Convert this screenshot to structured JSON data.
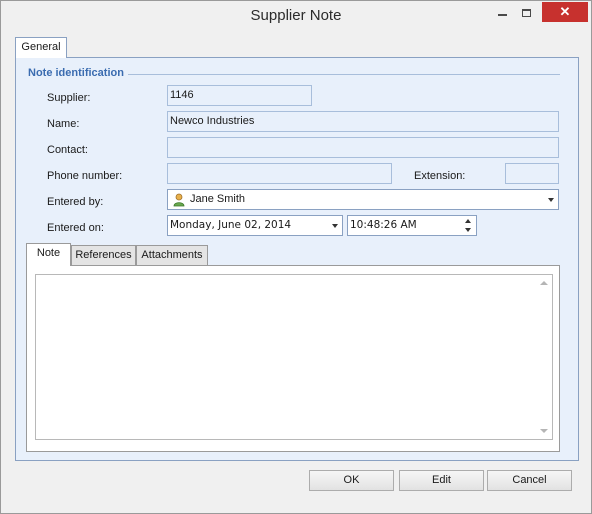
{
  "window": {
    "title": "Supplier Note",
    "controls": {
      "minimize": "minimize-icon",
      "maximize": "maximize-icon",
      "close_glyph": "✕"
    }
  },
  "tabs": {
    "general": "General"
  },
  "group": {
    "title": "Note identification"
  },
  "form": {
    "supplier_label": "Supplier:",
    "supplier_value": "1146",
    "name_label": "Name:",
    "name_value": "Newco Industries",
    "contact_label": "Contact:",
    "contact_value": "",
    "phone_label": "Phone number:",
    "phone_value": "",
    "extension_label": "Extension:",
    "extension_value": "",
    "entered_by_label": "Entered by:",
    "entered_by_value": "Jane Smith",
    "entered_on_label": "Entered on:",
    "entered_on_date": "Monday, June 02, 2014",
    "entered_on_time": "10:48:26 AM"
  },
  "inner_tabs": [
    {
      "label": "Note"
    },
    {
      "label": "References"
    },
    {
      "label": "Attachments"
    }
  ],
  "note": {
    "text": ""
  },
  "buttons": {
    "ok": "OK",
    "edit": "Edit",
    "cancel": "Cancel"
  },
  "colors": {
    "panel_bg": "#e8f0fb",
    "group_title": "#3b6cb0",
    "close_button": "#c7312e"
  }
}
